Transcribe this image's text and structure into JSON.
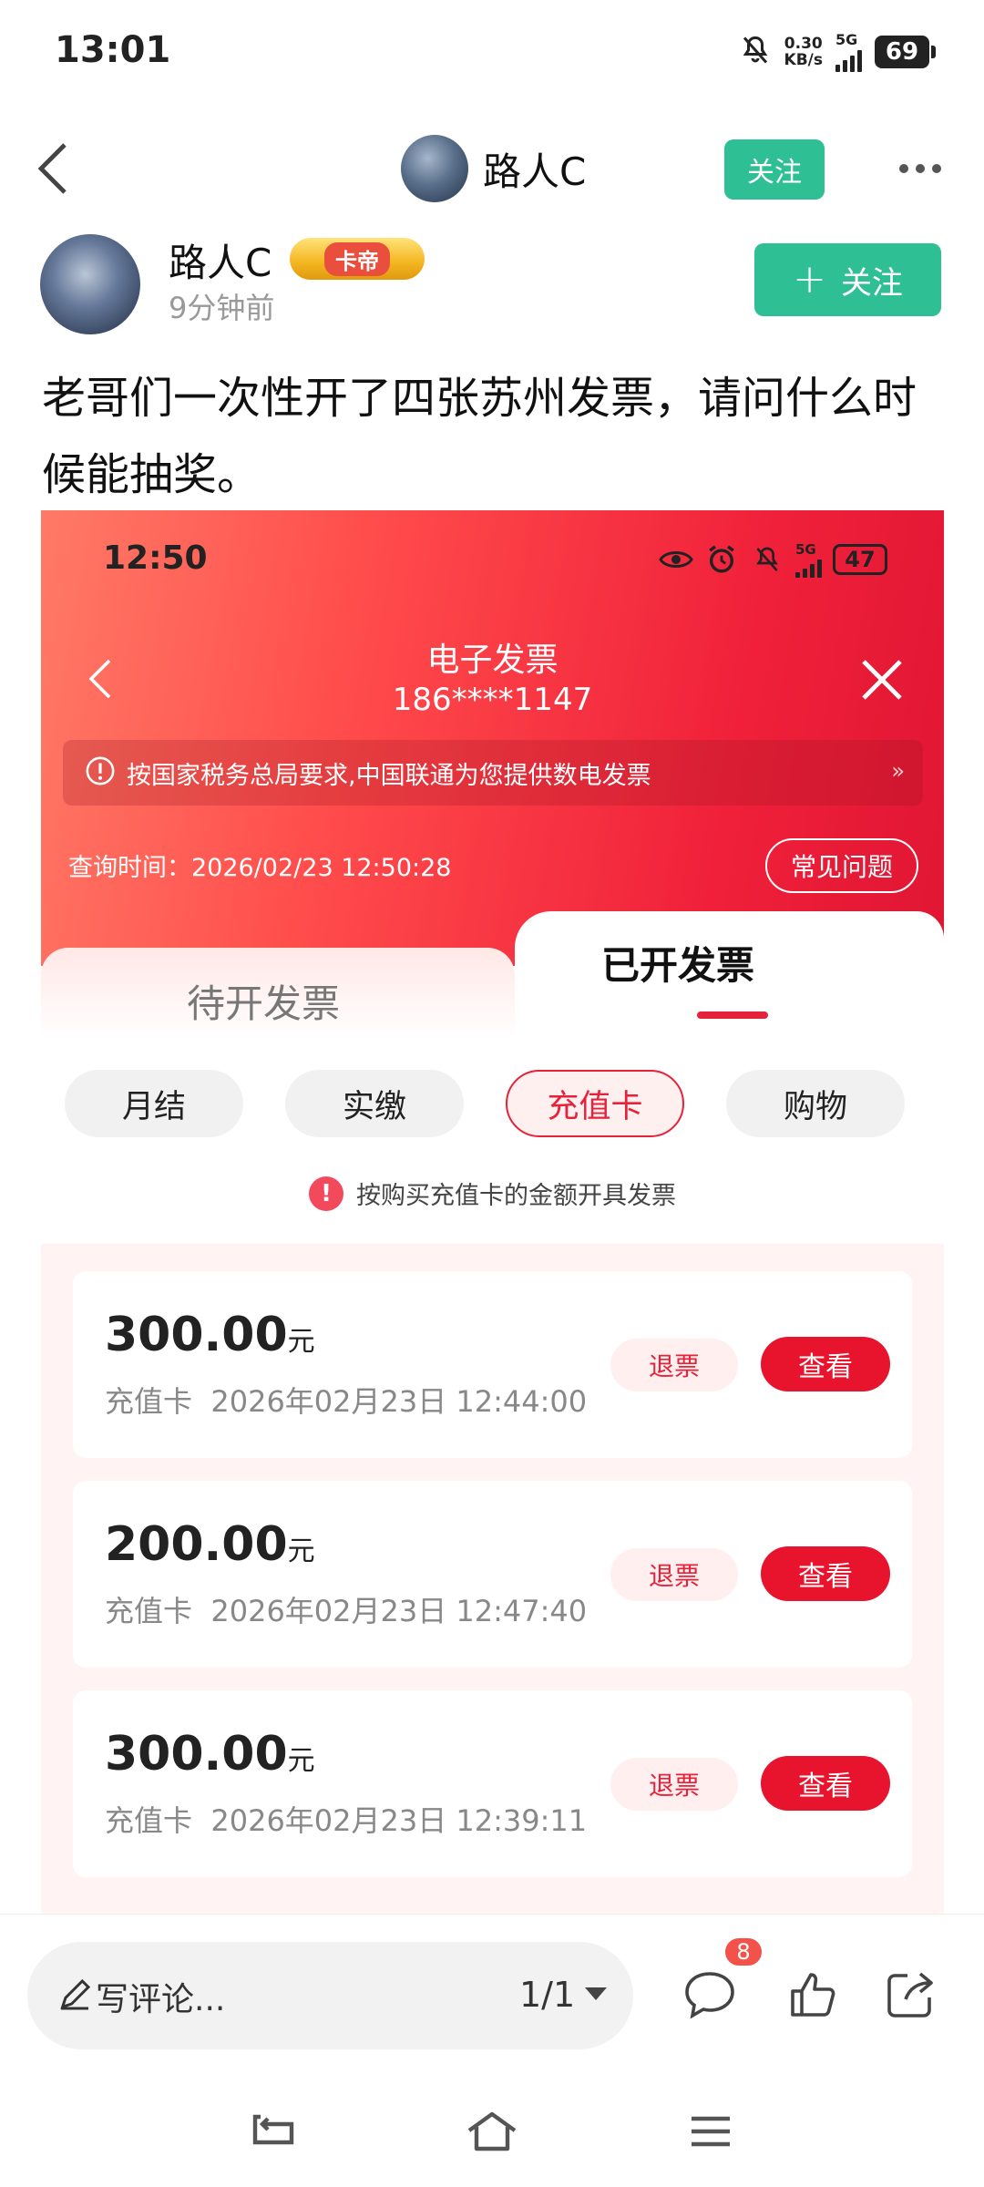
{
  "status_bar": {
    "time": "13:01",
    "speed_top": "0.30",
    "speed_unit": "KB/s",
    "network": "5G",
    "battery": "69"
  },
  "header": {
    "title": "路人C",
    "follow_label": "关注",
    "icons": [
      "back-arrow-icon",
      "more-dots-icon"
    ]
  },
  "author": {
    "name": "路人C",
    "badge": "卡帝",
    "time": "9分钟前",
    "follow_label": "关注",
    "follow_plus": "+"
  },
  "post": {
    "text": "老哥们一次性开了四张苏州发票，请问什么时候能抽奖。"
  },
  "screenshot": {
    "status_time": "12:50",
    "network": "5G",
    "battery": "47",
    "title": "电子发票",
    "phone": "186****1147",
    "notice": "按国家税务总局要求,中国联通为您提供数电发票",
    "notice_more": "»",
    "query_time": "查询时间：2026/02/23 12:50:28",
    "faq_label": "常见问题",
    "tabs": [
      "待开发票",
      "已开发票"
    ],
    "active_tab": "已开发票",
    "filters": [
      "月结",
      "实缴",
      "充值卡",
      "购物"
    ],
    "active_filter": "充值卡",
    "hint_icon": "!",
    "hint": "按购买充值卡的金额开具发票",
    "invoices": [
      {
        "amount": "300.00",
        "unit": "元",
        "type": "充值卡",
        "datetime": "2026年02月23日 12:44:00",
        "refund_label": "退票",
        "view_label": "查看"
      },
      {
        "amount": "200.00",
        "unit": "元",
        "type": "充值卡",
        "datetime": "2026年02月23日 12:47:40",
        "refund_label": "退票",
        "view_label": "查看"
      },
      {
        "amount": "300.00",
        "unit": "元",
        "type": "充值卡",
        "datetime": "2026年02月23日 12:39:11",
        "refund_label": "退票",
        "view_label": "查看"
      }
    ],
    "colors": {
      "accent": "#e6213a",
      "header_start": "#ff7a66",
      "header_end": "#e01633"
    }
  },
  "bottom_bar": {
    "comment_placeholder": "写评论...",
    "page_indicator": "1/1",
    "comment_count": "8",
    "icons": [
      "comment-icon",
      "like-icon",
      "share-icon"
    ]
  },
  "colors": {
    "brand_green": "#2fbf95"
  }
}
